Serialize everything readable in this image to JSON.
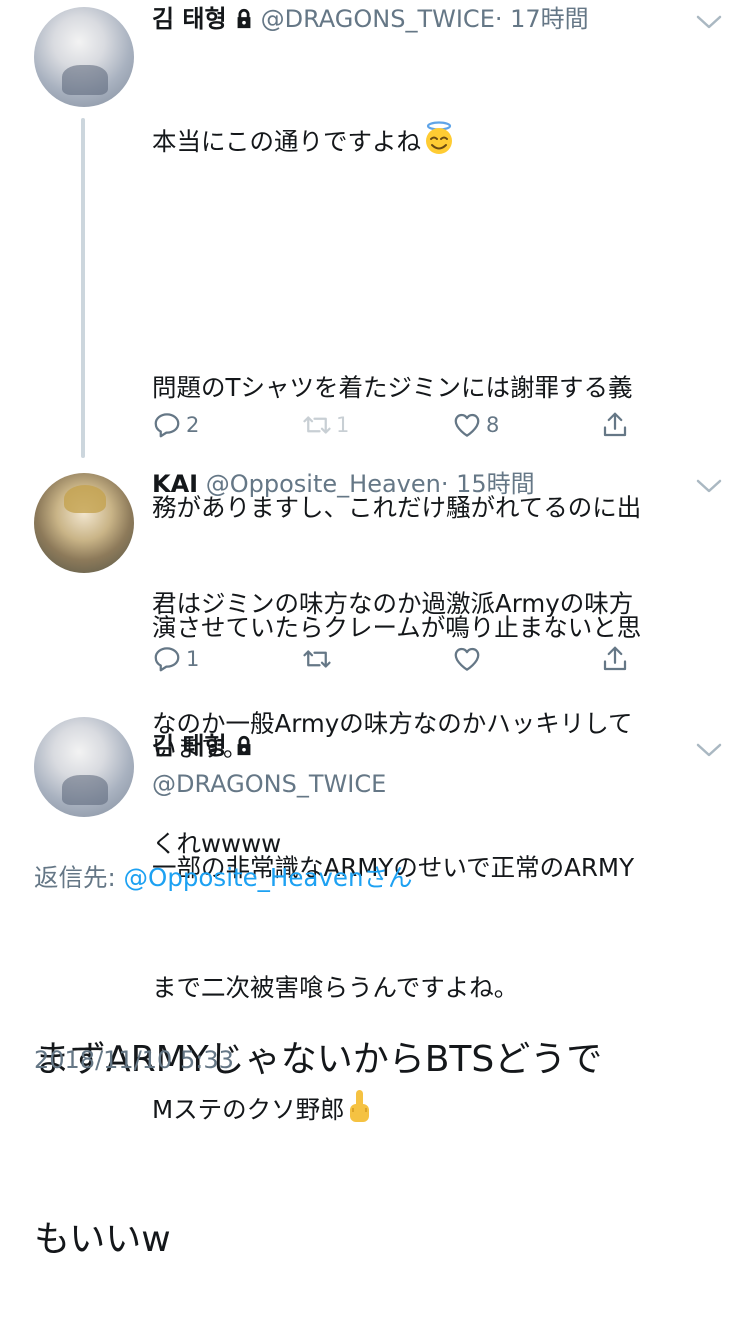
{
  "tweets": [
    {
      "name": "김 태형",
      "handle": "@DRAGONS_TWICE",
      "time": "· 17時間",
      "text_lines": [
        "本当にこの通りですよね",
        "",
        "問題のTシャツを着たジミンには謝罪する義",
        "務がありますし、これだけ騒がれてるのに出",
        "演させていたらクレームが鳴り止まないと思",
        "います。",
        "一部の非常識なARMYのせいで正常のARMY",
        "まで二次被害喰らうんですよね。",
        "Mステのクソ野郎"
      ],
      "reply_count": "2",
      "retweet_count": "1",
      "like_count": "8"
    },
    {
      "name": "KAI",
      "handle": "@Opposite_Heaven",
      "time": "· 15時間",
      "text_lines": [
        "君はジミンの味方なのか過激派Armyの味方",
        "なのか一般Armyの味方なのかハッキリして",
        "くれwwww"
      ],
      "reply_count": "1",
      "retweet_count": "",
      "like_count": ""
    }
  ],
  "main_tweet": {
    "name": "김 태형",
    "handle": "@DRAGONS_TWICE",
    "reply_to_label": "返信先: ",
    "reply_to_user": "@Opposite_Heavenさん",
    "text_lines": [
      "まずARMYじゃないからBTSどうで",
      "もいいw"
    ],
    "timestamp": "2018/11/10 5:33"
  },
  "colors": {
    "link": "#1da1f2",
    "secondary": "#657786",
    "thread_line": "#ccd6dd"
  },
  "icons": [
    "lock-icon",
    "chevron-down-icon",
    "reply-icon",
    "retweet-icon",
    "like-icon",
    "share-icon",
    "angel-emoji",
    "middle-finger-emoji"
  ]
}
